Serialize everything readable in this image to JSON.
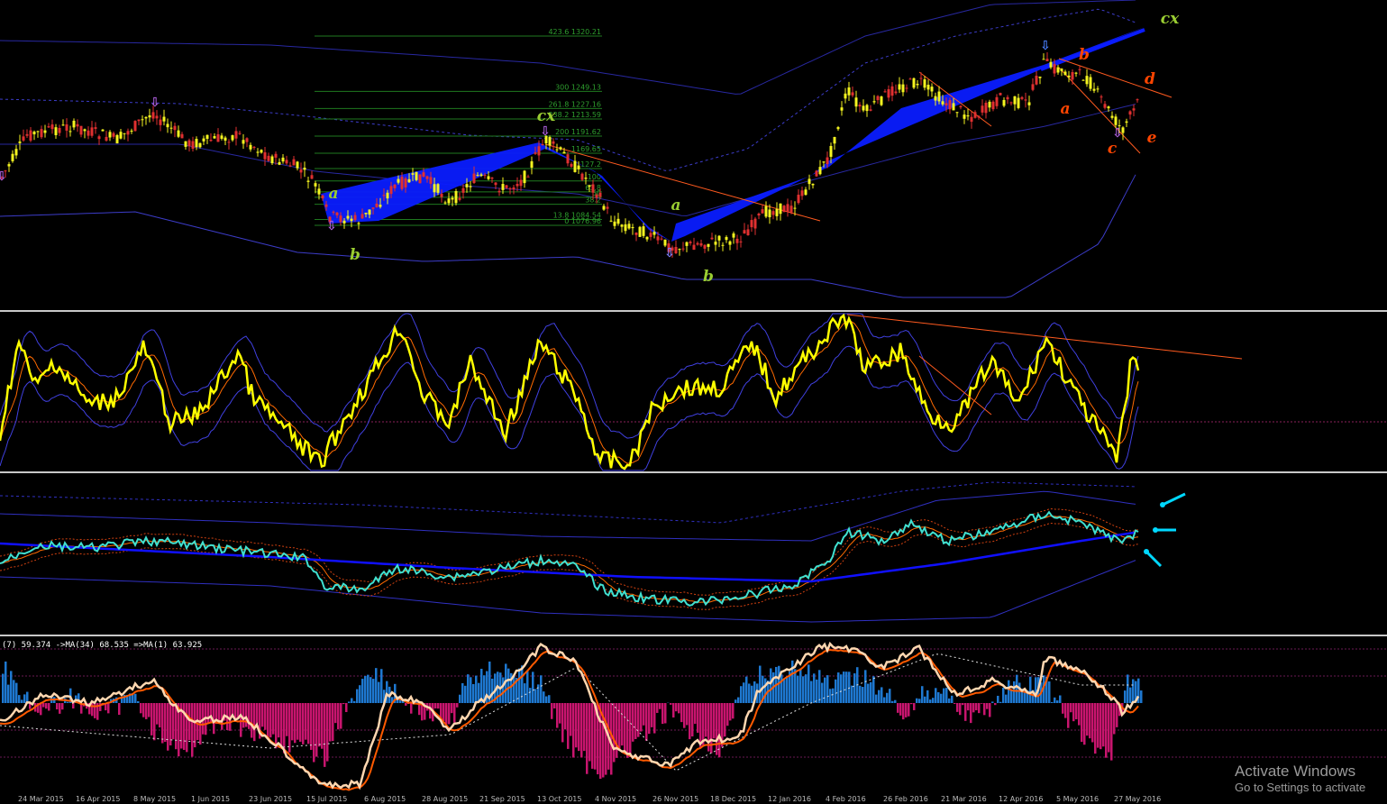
{
  "chart_data": [
    {
      "type": "line",
      "pane": "price",
      "fib_levels": [
        {
          "label": "423.6 1320.21",
          "price": 1320.21
        },
        {
          "label": "300 1249.13",
          "price": 1249.13
        },
        {
          "label": "261.8 1227.16",
          "price": 1227.16
        },
        {
          "label": "238.2 1213.59",
          "price": 1213.59
        },
        {
          "label": "200 1191.62",
          "price": 1191.62
        },
        {
          "label": "1169.65",
          "price": 1169.65
        },
        {
          "label": "127.2",
          "price": 1150.0
        },
        {
          "label": "100",
          "price": 1134.0
        },
        {
          "label": "61.8",
          "price": 1120.0
        },
        {
          "label": "50",
          "price": 1113.0
        },
        {
          "label": "38.2",
          "price": 1104.0
        },
        {
          "label": "13.8 1084.54",
          "price": 1084.54
        },
        {
          "label": "0 1076.96",
          "price": 1076.96
        }
      ],
      "pattern_labels": [
        {
          "text": "a",
          "color": "#9acd32"
        },
        {
          "text": "b",
          "color": "#9acd32"
        },
        {
          "text": "cx",
          "color": "#9acd32"
        },
        {
          "text": "a",
          "color": "#9acd32"
        },
        {
          "text": "b",
          "color": "#9acd32"
        },
        {
          "text": "cx",
          "color": "#9acd32"
        },
        {
          "text": "b",
          "color": "#ff4500"
        },
        {
          "text": "d",
          "color": "#ff4500"
        },
        {
          "text": "a",
          "color": "#ff4500"
        },
        {
          "text": "c",
          "color": "#ff4500"
        },
        {
          "text": "e",
          "color": "#ff4500"
        }
      ],
      "colors": {
        "bull": "#f5f520",
        "bear": "#e03030",
        "wave_fill": "#0a1cff",
        "trend": "#ff5a1f",
        "band": "#3c3cc8"
      }
    },
    {
      "type": "line",
      "pane": "oscillator",
      "series": [
        {
          "color": "#ffff00"
        },
        {
          "color": "#ff6a00"
        },
        {
          "color": "#5050ff"
        }
      ]
    },
    {
      "type": "line",
      "pane": "cyan-oscillator",
      "series": [
        {
          "color": "#40e0d0"
        },
        {
          "color": "#1010ff"
        },
        {
          "color": "#ff6a00"
        }
      ]
    },
    {
      "type": "bar",
      "pane": "histogram",
      "label": "(7) 59.374  ->MA(34) 68.535  =>MA(1) 63.925",
      "series": [
        {
          "color": "#1e78d0"
        },
        {
          "color": "#c8156e"
        },
        {
          "color": "#ffd7b0"
        },
        {
          "color": "#ff5a00"
        }
      ]
    }
  ],
  "x_axis_ticks": [
    "24 Mar 2015",
    "16 Apr 2015",
    "8 May 2015",
    "1 Jun 2015",
    "23 Jun 2015",
    "15 Jul 2015",
    "6 Aug 2015",
    "28 Aug 2015",
    "21 Sep 2015",
    "13 Oct 2015",
    "4 Nov 2015",
    "26 Nov 2015",
    "18 Dec 2015",
    "12 Jan 2016",
    "4 Feb 2016",
    "26 Feb 2016",
    "21 Mar 2016",
    "12 Apr 2016",
    "5 May 2016",
    "27 May 2016"
  ],
  "watermark": {
    "title": "Activate Windows",
    "subtitle": "Go to Settings to activate"
  }
}
